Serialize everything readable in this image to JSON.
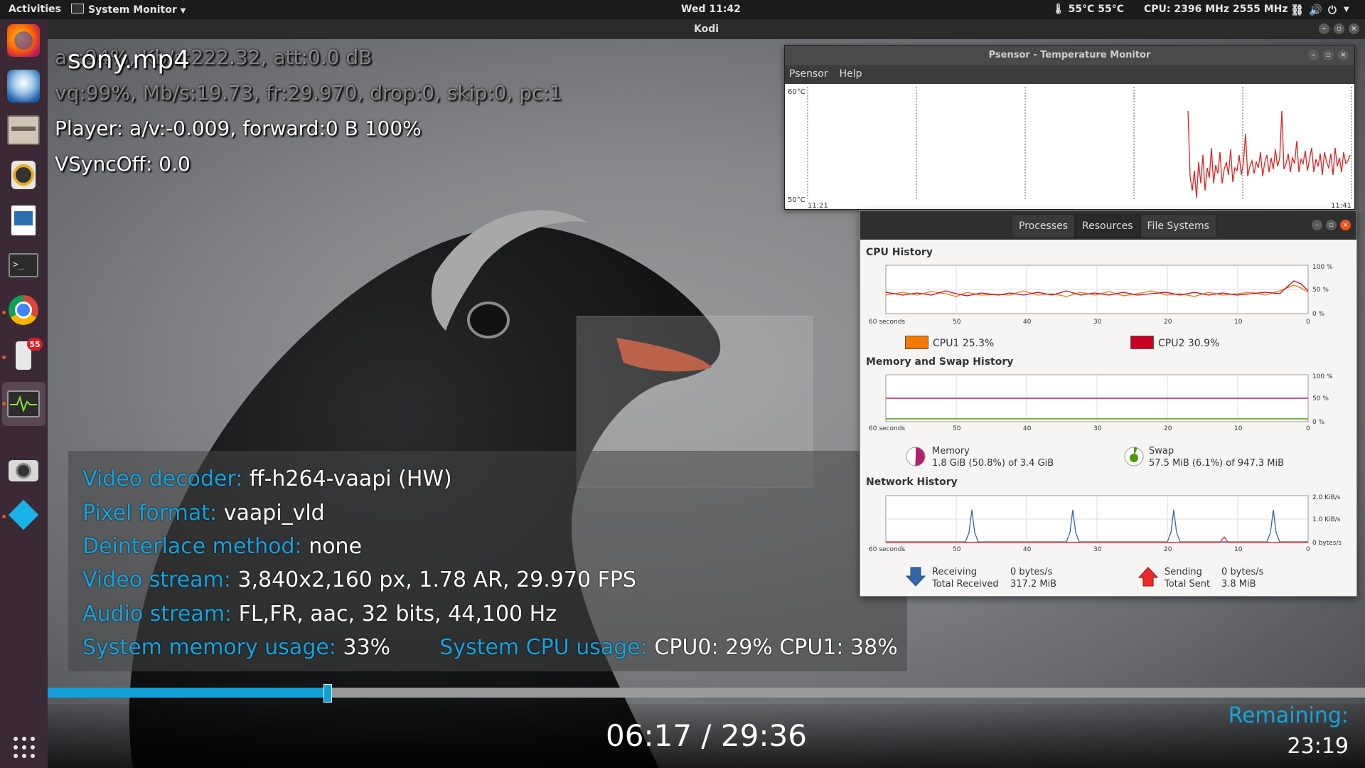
{
  "topbar": {
    "activities": "Activities",
    "app_menu": "System Monitor",
    "clock": "Wed 11:42",
    "temps": "55°C 55°C",
    "cpu_freq": "CPU: 2396 MHz 2555 MHz"
  },
  "dock": {
    "badge_count": "55"
  },
  "kodi": {
    "window_title": "Kodi",
    "filename": "sony.mp4",
    "audio_debug": "ac:94%, Kb/s:222.32, att:0.0 dB",
    "video_debug": "vq:99%, Mb/s:19.73, fr:29.970, drop:0, skip:0, pc:1",
    "player_debug": "Player: a/v:-0.009,  forward:0 B 100%",
    "vsync": "VSyncOff: 0.0",
    "info": {
      "video_decoder_label": "Video decoder:",
      "video_decoder_value": "ff-h264-vaapi (HW)",
      "pixel_format_label": "Pixel format:",
      "pixel_format_value": "vaapi_vld",
      "deinterlace_label": "Deinterlace method:",
      "deinterlace_value": "none",
      "video_stream_label": "Video stream:",
      "video_stream_value": "3,840x2,160 px, 1.78 AR, 29.970 FPS",
      "audio_stream_label": "Audio stream:",
      "audio_stream_value": "FL,FR, aac, 32 bits, 44,100 Hz",
      "sys_mem_label": "System memory usage:",
      "sys_mem_value": "33%",
      "sys_cpu_label": "System CPU usage:",
      "sys_cpu_value": "CPU0:  29% CPU1:  38%"
    },
    "progress_fraction": 0.212,
    "time": "06:17 / 29:36",
    "remaining_label": "Remaining:",
    "remaining_value": "23:19"
  },
  "psensor": {
    "title": "Psensor - Temperature Monitor",
    "menu": [
      "Psensor",
      "Help"
    ],
    "y_max": "60°C",
    "y_min": "50°C",
    "x_start": "11:21",
    "x_end": "11:41"
  },
  "sysmon": {
    "tabs": [
      "Processes",
      "Resources",
      "File Systems"
    ],
    "cpu_title": "CPU History",
    "mem_title": "Memory and Swap History",
    "net_title": "Network History",
    "x_ticks": [
      "60 seconds",
      "50",
      "40",
      "30",
      "20",
      "10",
      "0"
    ],
    "pct_ticks": [
      "100 %",
      "50 %",
      "0 %"
    ],
    "net_ticks": [
      "2.0 KiB/s",
      "1.0 KiB/s",
      "0 bytes/s"
    ],
    "cpu1": "CPU1  25.3%",
    "cpu2": "CPU2  30.9%",
    "memory_label": "Memory",
    "memory_value": "1.8 GiB (50.8%) of 3.4 GiB",
    "swap_label": "Swap",
    "swap_value": "57.5 MiB (6.1%) of 947.3 MiB",
    "receiving_label": "Receiving",
    "total_received_label": "Total Received",
    "receiving_value": "0 bytes/s",
    "total_received_value": "317.2 MiB",
    "sending_label": "Sending",
    "total_sent_label": "Total Sent",
    "sending_value": "0 bytes/s",
    "total_sent_value": "3.8 MiB",
    "colors": {
      "cpu1": "#f57900",
      "cpu2": "#cc0022",
      "memory": "#b0206e",
      "swap": "#4e9a06",
      "receive": "#3465a4",
      "send": "#ef2929"
    }
  }
}
